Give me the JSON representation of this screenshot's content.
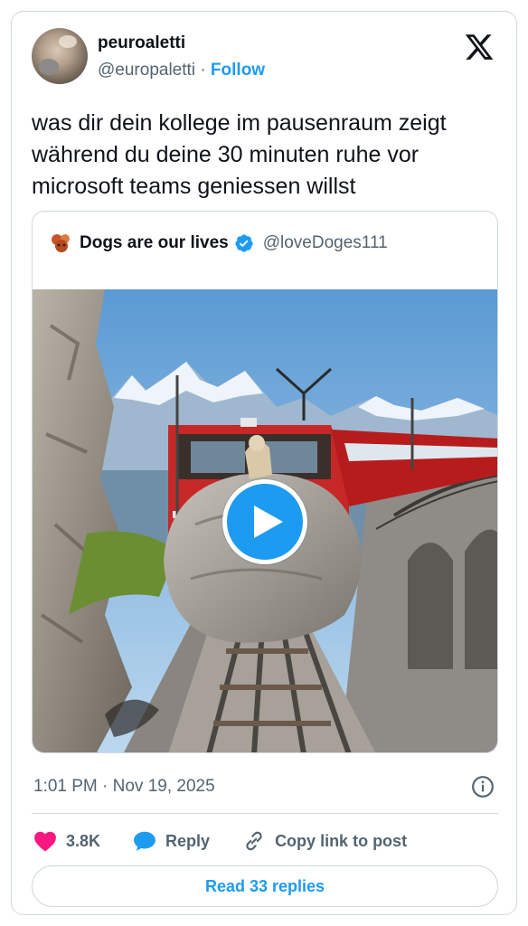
{
  "author": {
    "display_name": "peuroaletti",
    "handle": "@europaletti",
    "separator": "·",
    "follow_label": "Follow"
  },
  "tweet": {
    "text": "was dir dein kollege im pausenraum zeigt während du deine 30 minuten ruhe vor microsoft teams geniessen willst",
    "timestamp": "1:01 PM · Nov 19, 2025"
  },
  "quoted": {
    "display_name": "Dogs are our lives",
    "handle": "@loveDoges111"
  },
  "actions": {
    "likes": "3.8K",
    "reply_label": "Reply",
    "copy_label": "Copy link to post",
    "read_replies": "Read 33 replies"
  },
  "icons": {
    "x_logo": "x-logo-icon",
    "verified": "verified-badge-icon",
    "play": "play-icon",
    "info": "info-icon",
    "like": "heart-icon",
    "reply": "speech-bubble-icon",
    "copy": "link-icon"
  },
  "colors": {
    "accent": "#1d9bf0",
    "like": "#f91880",
    "secondary_text": "#536471",
    "border": "#cfd9de"
  }
}
